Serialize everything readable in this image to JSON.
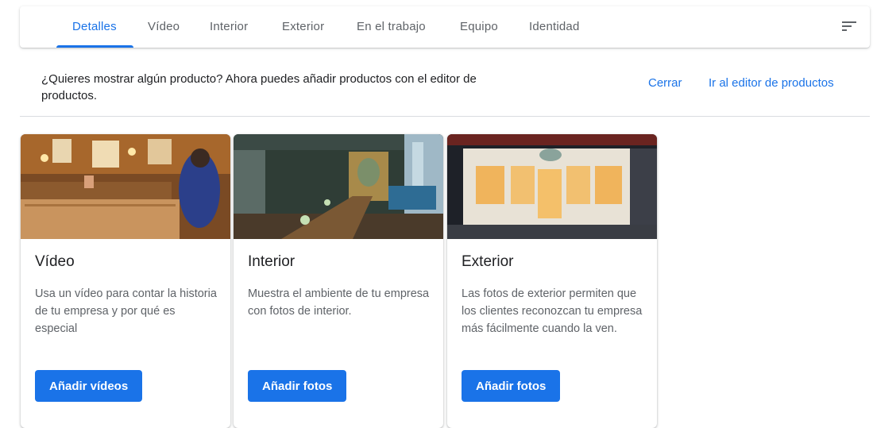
{
  "tabs": [
    {
      "label": "Detalles"
    },
    {
      "label": "Vídeo"
    },
    {
      "label": "Interior"
    },
    {
      "label": "Exterior"
    },
    {
      "label": "En el trabajo"
    },
    {
      "label": "Equipo"
    },
    {
      "label": "Identidad"
    }
  ],
  "active_tab": "Detalles",
  "sort_icon": "sort-icon",
  "banner": {
    "text": "¿Quieres mostrar algún producto? Ahora puedes añadir productos con el editor de productos.",
    "close_label": "Cerrar",
    "editor_label": "Ir al editor de productos"
  },
  "cards": [
    {
      "title": "Vídeo",
      "description": "Usa un vídeo para contar la historia de tu empresa y por qué es especial",
      "button": "Añadir vídeos"
    },
    {
      "title": "Interior",
      "description": "Muestra el ambiente de tu empresa con fotos de interior.",
      "button": "Añadir fotos"
    },
    {
      "title": "Exterior",
      "description": "Las fotos de exterior permiten que los clientes reconozcan tu empresa más fácilmente cuando la ven.",
      "button": "Añadir fotos"
    }
  ],
  "colors": {
    "accent": "#1a73e8",
    "text": "#202124",
    "secondary_text": "#5f6368"
  }
}
